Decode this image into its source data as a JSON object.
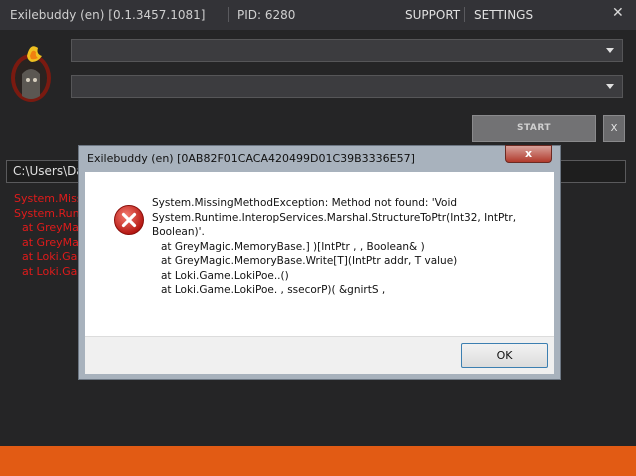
{
  "titlebar": {
    "title": "Exilebuddy (en) [0.1.3457.1081]",
    "pid": "PID: 6280",
    "support": "SUPPORT",
    "settings": "SETTINGS",
    "close": "✕"
  },
  "controls": {
    "start_label": "START",
    "x_label": "X"
  },
  "path": {
    "value": "C:\\Users\\Da"
  },
  "log": [
    "System.Miss",
    "System.Runti",
    "   at GreyMa",
    "   at GreyMa",
    "   at Loki.Gam",
    "   at Loki.Gam"
  ],
  "dialog": {
    "title": "Exilebuddy (en) [0AB82F01CACA420499D01C39B3336E57]",
    "close": "x",
    "message": [
      "System.MissingMethodException: Method not found: 'Void",
      "System.Runtime.InteropServices.Marshal.StructureToPtr(Int32, IntPtr,",
      "Boolean)'.",
      "at GreyMagic.MemoryBase.]    )[IntPtr ,       , Boolean& )",
      "at GreyMagic.MemoryBase.Write[T](IntPtr addr, T value)",
      "at Loki.Game.LokiPoe..()",
      "at Loki.Game.LokiPoe. , ssecorP)( &gnirtS ,"
    ],
    "ok_label": "OK"
  },
  "colors": {
    "accent_orange": "#e25b14",
    "log_error": "#e01b1b",
    "error_icon": "#c8201c"
  }
}
